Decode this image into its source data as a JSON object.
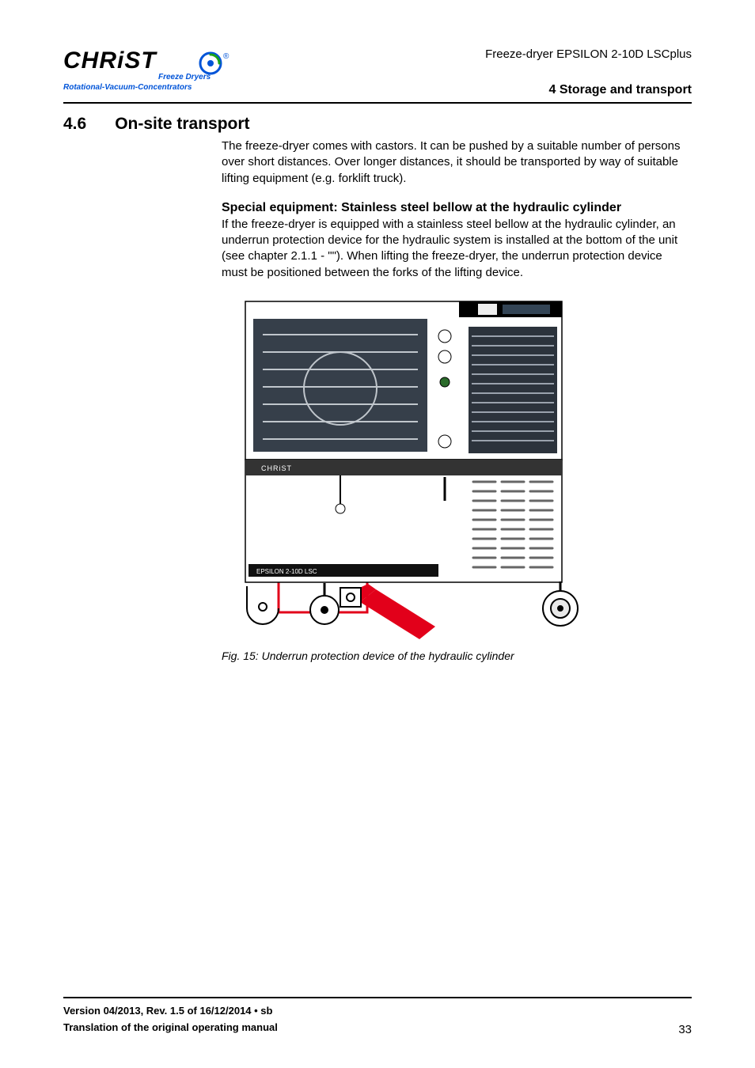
{
  "header": {
    "doc_title": "Freeze-dryer EPSILON 2-10D LSCplus",
    "chapter_title": "4 Storage and transport"
  },
  "logo": {
    "brand_word": "CHRiST",
    "tagline1": "Freeze Dryers",
    "tagline2": "Rotational-Vacuum-Concentrators"
  },
  "section": {
    "number": "4.6",
    "title": "On-site transport"
  },
  "body": {
    "para1": "The freeze-dryer comes with castors. It can be pushed by a suitable number of persons over short distances. Over longer distances, it should be transported by way of suitable lifting equipment (e.g. forklift truck).",
    "subheading": "Special equipment: Stainless steel bellow at the hydraulic cylinder",
    "para2": "If the freeze-dryer is equipped with a stainless steel bellow at the hydraulic cylinder, an underrun protection device for the hydraulic system is installed at the bottom of the unit (see chapter 2.1.1 - \"\"). When lifting the freeze-dryer, the underrun protection device must be positioned between the forks of the lifting device."
  },
  "figure": {
    "caption": "Fig. 15: Underrun protection device of the hydraulic cylinder"
  },
  "footer": {
    "version_line": "Version 04/2013, Rev. 1.5 of 16/12/2014 • sb",
    "translation_line": "Translation of the original operating manual",
    "page_number": "33"
  }
}
